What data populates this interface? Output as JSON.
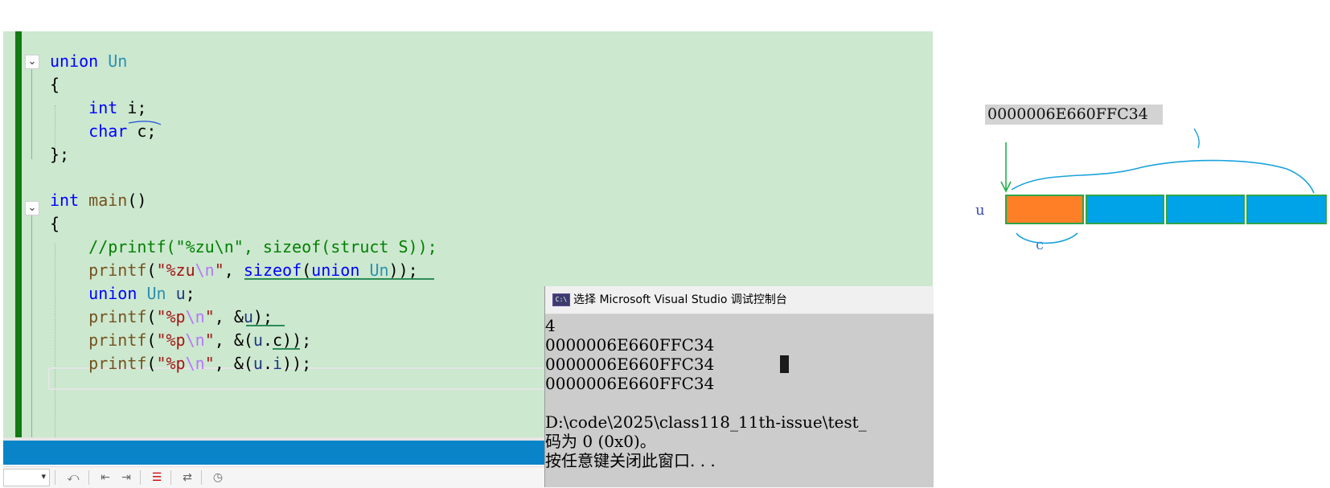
{
  "code": {
    "lines": {
      "l1_kw": "union",
      "l1_type": "Un",
      "l2": "{",
      "l3_kw": "int",
      "l3_rest": " i;",
      "l4_kw": "char",
      "l4_rest": " c;",
      "l5": "};",
      "l7_kw": "int",
      "l7_fn": "main",
      "l7_rest": "()",
      "l8": "{",
      "l9_comment": "//printf(\"%zu\\n\", sizeof(struct S));",
      "l10_fn": "printf",
      "l10_p1": "(",
      "l10_str1": "\"%zu",
      "l10_esc": "\\n",
      "l10_str2": "\"",
      "l10_p2": ", ",
      "l10_kw": "sizeof",
      "l10_p3": "(",
      "l10_kw2": "union",
      "l10_sp": " ",
      "l10_type": "Un",
      "l10_p4": "));",
      "l11_kw": "union",
      "l11_type": "Un",
      "l11_var": "u",
      "l11_p": ";",
      "l12_fn": "printf",
      "l12_p1": "(",
      "l12_str1": "\"%p",
      "l12_esc": "\\n",
      "l12_str2": "\"",
      "l12_p2": ", &",
      "l12_var": "u",
      "l12_p3": ");",
      "l13_fn": "printf",
      "l13_p1": "(",
      "l13_str1": "\"%p",
      "l13_esc": "\\n",
      "l13_str2": "\"",
      "l13_p2": ", &(",
      "l13_var": "u",
      "l13_p3": ".c));",
      "l14_fn": "printf",
      "l14_p1": "(",
      "l14_str1": "\"%p",
      "l14_esc": "\\n",
      "l14_str2": "\"",
      "l14_p2": ", &(",
      "l14_var": "u",
      "l14_dot": ".",
      "l14_var2": "i",
      "l14_p3": "));"
    },
    "fold_glyph": "⌄"
  },
  "console": {
    "title": "选择 Microsoft Visual Studio 调试控制台",
    "icon_text": "C:\\",
    "lines": [
      "4",
      "0000006E660FFC34",
      "0000006E660FFC34",
      "0000006E660FFC34",
      "",
      "D:\\code\\2025\\class118_11th-issue\\test_",
      "码为 0 (0x0)。",
      "按任意键关闭此窗口. . ."
    ]
  },
  "diagram": {
    "address": "0000006E660FFC34",
    "u_label": "u",
    "c_label": "c",
    "colors": {
      "orange": "#ff7f27",
      "blue": "#00a2e8",
      "border": "#2ea64a"
    }
  },
  "toolbar": {
    "icons": [
      "dropdown-icon",
      "undo-icon",
      "outdent-icon",
      "indent-icon",
      "clear-bookmarks-icon",
      "replace-icon",
      "history-icon"
    ]
  },
  "colors": {
    "editor_bg": "#cce8cf",
    "statusbar": "#0a84c8",
    "console_bg": "#cccccc"
  }
}
